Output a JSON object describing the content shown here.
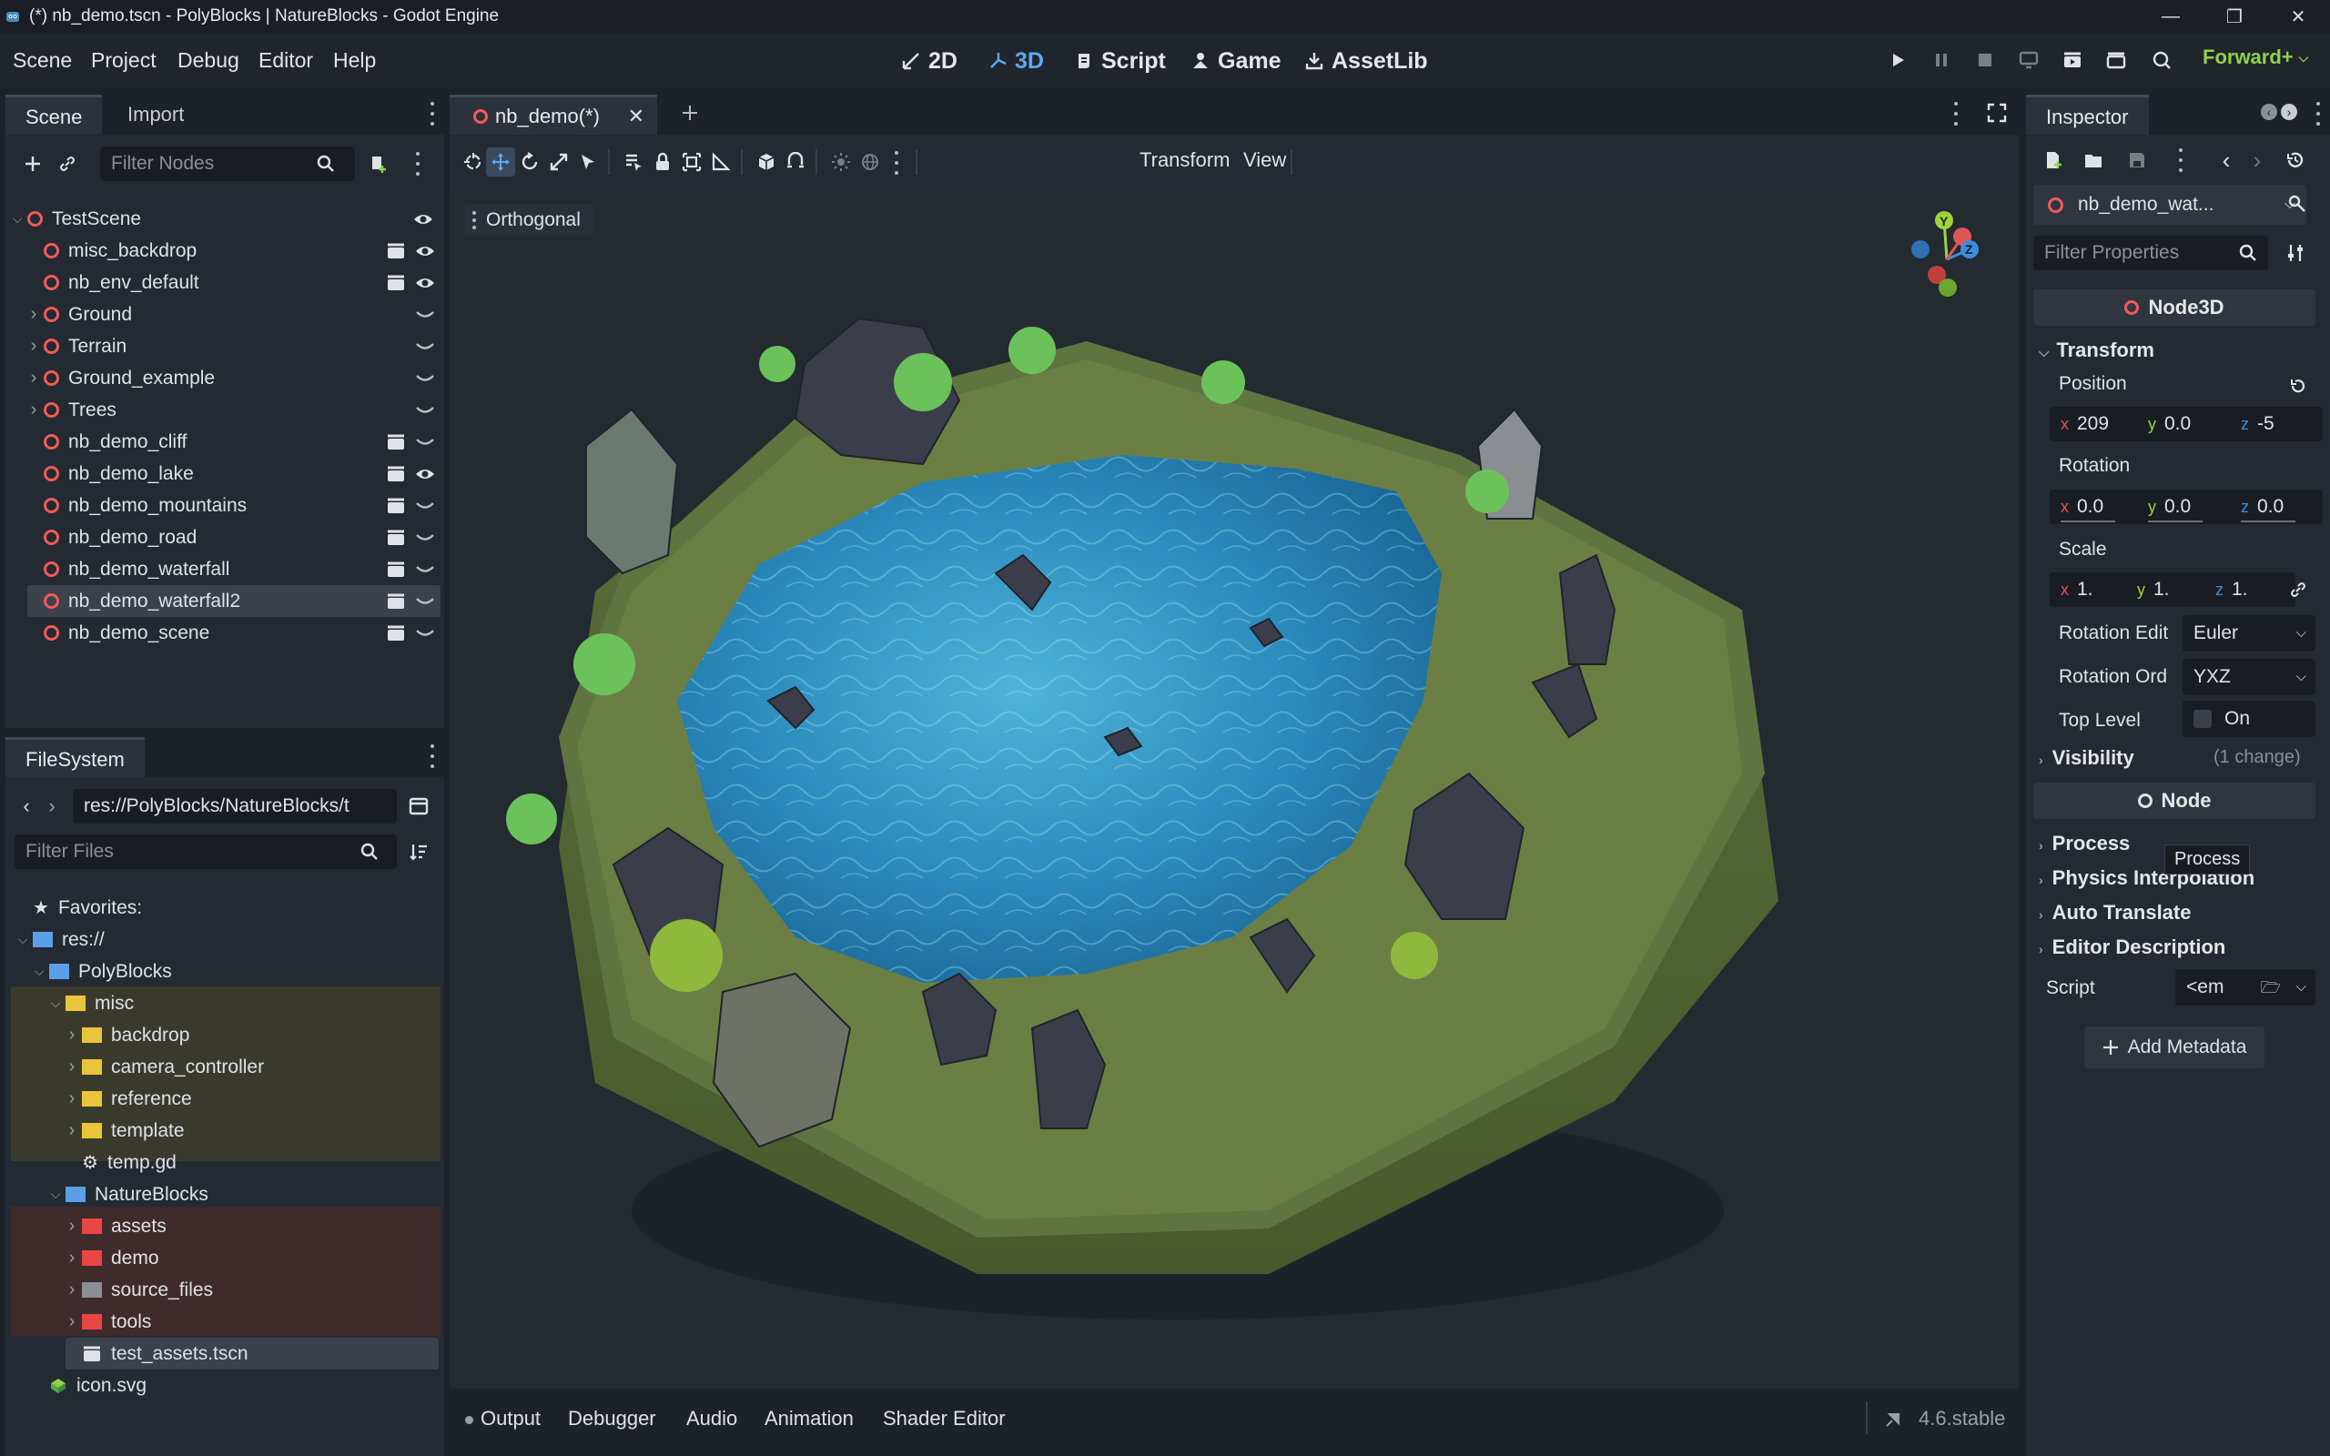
{
  "window": {
    "title": "(*) nb_demo.tscn - PolyBlocks | NatureBlocks - Godot Engine",
    "controls": [
      "minimize",
      "maximize",
      "close"
    ]
  },
  "menu": [
    "Scene",
    "Project",
    "Debug",
    "Editor",
    "Help"
  ],
  "workspaces": [
    {
      "label": "2D",
      "icon": "2d-icon"
    },
    {
      "label": "3D",
      "icon": "3d-icon",
      "active": true
    },
    {
      "label": "Script",
      "icon": "script-icon"
    },
    {
      "label": "Game",
      "icon": "game-icon"
    },
    {
      "label": "AssetLib",
      "icon": "assetlib-icon"
    }
  ],
  "renderer": "Forward+",
  "scene_dock": {
    "tabs": [
      "Scene",
      "Import"
    ],
    "filter_placeholder": "Filter Nodes",
    "root": "TestScene",
    "nodes": [
      {
        "name": "misc_backdrop",
        "expandable": false,
        "icons": [
          "scene",
          "visible"
        ]
      },
      {
        "name": "nb_env_default",
        "expandable": false,
        "icons": [
          "scene",
          "visible"
        ]
      },
      {
        "name": "Ground",
        "expandable": true,
        "icons": [
          "hidden"
        ]
      },
      {
        "name": "Terrain",
        "expandable": true,
        "icons": [
          "hidden"
        ]
      },
      {
        "name": "Ground_example",
        "expandable": true,
        "icons": [
          "hidden"
        ]
      },
      {
        "name": "Trees",
        "expandable": true,
        "icons": [
          "hidden"
        ]
      },
      {
        "name": "nb_demo_cliff",
        "expandable": false,
        "icons": [
          "scene",
          "hidden"
        ]
      },
      {
        "name": "nb_demo_lake",
        "expandable": false,
        "icons": [
          "scene",
          "visible"
        ]
      },
      {
        "name": "nb_demo_mountains",
        "expandable": false,
        "icons": [
          "scene",
          "hidden"
        ]
      },
      {
        "name": "nb_demo_road",
        "expandable": false,
        "icons": [
          "scene",
          "hidden"
        ]
      },
      {
        "name": "nb_demo_waterfall",
        "expandable": false,
        "icons": [
          "scene",
          "hidden"
        ]
      },
      {
        "name": "nb_demo_waterfall2",
        "expandable": false,
        "icons": [
          "scene",
          "hidden"
        ],
        "selected": true
      },
      {
        "name": "nb_demo_scene",
        "expandable": false,
        "icons": [
          "scene",
          "hidden"
        ]
      }
    ]
  },
  "filesystem": {
    "tab": "FileSystem",
    "path": "res://PolyBlocks/NatureBlocks/t",
    "filter_placeholder": "Filter Files",
    "favorites": "Favorites:",
    "res_root": "res://",
    "polyblocks": "PolyBlocks",
    "misc": "misc",
    "misc_children": [
      "backdrop",
      "camera_controller",
      "reference",
      "template"
    ],
    "temp_file": "temp.gd",
    "natureblocks": "NatureBlocks",
    "nature_children": [
      {
        "name": "assets",
        "color": "#e84545"
      },
      {
        "name": "demo",
        "color": "#e84545"
      },
      {
        "name": "source_files",
        "color": "#8a8f96"
      },
      {
        "name": "tools",
        "color": "#e84545"
      }
    ],
    "test_assets": "test_assets.tscn",
    "icon_file": "icon.svg"
  },
  "editor_tabs": {
    "active": "nb_demo(*)"
  },
  "toolbar": {
    "transform_menu": "Transform",
    "view_menu": "View"
  },
  "viewport": {
    "projection": "Orthogonal",
    "gizmo_axes": [
      "Y",
      "Z"
    ]
  },
  "bottom_panel": {
    "tabs": [
      "Output",
      "Debugger",
      "Audio",
      "Animation",
      "Shader Editor"
    ],
    "version": "4.6.stable"
  },
  "inspector": {
    "tab": "Inspector",
    "object": "nb_demo_wat...",
    "filter_placeholder": "Filter Properties",
    "class_header": "Node3D",
    "transform_section": "Transform",
    "position_label": "Position",
    "position": {
      "x": "209",
      "y": "0.0",
      "z": "-5"
    },
    "rotation_label": "Rotation",
    "rotation": {
      "x": "0.0",
      "y": "0.0",
      "z": "0.0"
    },
    "scale_label": "Scale",
    "scale": {
      "x": "1.",
      "y": "1.",
      "z": "1."
    },
    "rotation_edit_label": "Rotation Edit",
    "rotation_edit_value": "Euler",
    "rotation_order_label": "Rotation Ord",
    "rotation_order_value": "YXZ",
    "top_level_label": "Top Level",
    "top_level_value": "On",
    "visibility_section": "Visibility",
    "visibility_note": "(1 change)",
    "node_header": "Node",
    "process_section": "Process",
    "physics_section": "Physics Interpolation",
    "auto_translate_section": "Auto Translate",
    "editor_description_section": "Editor Description",
    "script_label": "Script",
    "script_value": "<em",
    "add_metadata": "Add Metadata",
    "tooltip": "Process"
  },
  "colors": {
    "accent": "#5ea8f5",
    "node_icon": "#f25a5a",
    "folder_yellow": "#e8c53a",
    "folder_red": "#e84545",
    "folder_blue": "#5a9fe8",
    "misc_highlight": "#3a3a2c",
    "nature_highlight": "#3f2a2c",
    "axis_x": "#e05555",
    "axis_y": "#9fd43c",
    "axis_z": "#3c8de0"
  }
}
